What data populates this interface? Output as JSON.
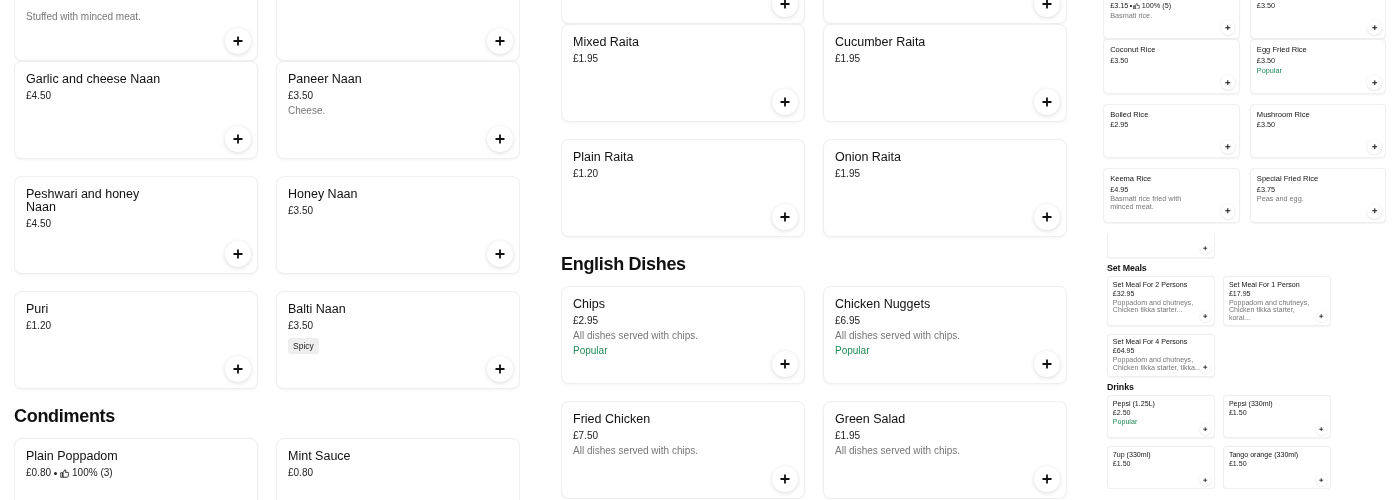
{
  "left_column": {
    "sections": [
      {
        "items": [
          {
            "kind": "tail",
            "description": "Stuffed with minced meat."
          },
          {
            "kind": "tail"
          }
        ]
      },
      {
        "items": [
          {
            "kind": "full",
            "name": "Garlic and cheese Naan",
            "price": "£4.50"
          },
          {
            "kind": "full",
            "name": "Paneer Naan",
            "price": "£3.50",
            "description": "Cheese."
          },
          {
            "kind": "full",
            "name": "Peshwari and honey Naan",
            "price": "£4.50"
          },
          {
            "kind": "full",
            "name": "Honey Naan",
            "price": "£3.50"
          },
          {
            "kind": "full",
            "name": "Puri",
            "price": "£1.20"
          },
          {
            "kind": "full",
            "name": "Balti Naan",
            "price": "£3.50",
            "tag": {
              "kind": "spicy",
              "text": "Spicy"
            }
          }
        ]
      },
      {
        "heading": "Condiments",
        "items": [
          {
            "kind": "head",
            "name": "Plain Poppadom",
            "price": "£0.80",
            "rating": "100% (3)"
          },
          {
            "kind": "head",
            "name": "Mint Sauce",
            "price": "£0.80"
          }
        ]
      }
    ]
  },
  "middle_column": {
    "sections": [
      {
        "items": [
          {
            "kind": "tail"
          },
          {
            "kind": "tail"
          }
        ]
      },
      {
        "items": [
          {
            "kind": "full",
            "name": "Mixed Raita",
            "price": "£1.95"
          },
          {
            "kind": "full",
            "name": "Cucumber Raita",
            "price": "£1.95"
          },
          {
            "kind": "full",
            "name": "Plain Raita",
            "price": "£1.20"
          },
          {
            "kind": "full",
            "name": "Onion Raita",
            "price": "£1.95"
          }
        ]
      },
      {
        "heading": "English Dishes",
        "items": [
          {
            "kind": "full",
            "name": "Chips",
            "price": "£2.95",
            "description": "All dishes served with chips.",
            "tag": {
              "kind": "popular",
              "text": "Popular"
            }
          },
          {
            "kind": "full",
            "name": "Chicken Nuggets",
            "price": "£6.95",
            "description": "All dishes served with chips.",
            "tag": {
              "kind": "popular",
              "text": "Popular"
            }
          },
          {
            "kind": "full",
            "name": "Fried Chicken",
            "price": "£7.50",
            "description": "All dishes served with chips."
          },
          {
            "kind": "full",
            "name": "Green Salad",
            "price": "£1.95",
            "description": "All dishes served with chips."
          }
        ]
      }
    ]
  },
  "right_column": {
    "upper": {
      "sections": [
        {
          "items": [
            {
              "kind": "tail",
              "price": "£3.15",
              "rating": "100% (5)",
              "description": "Basmati rice."
            },
            {
              "kind": "tail",
              "price": "£3.50"
            }
          ]
        },
        {
          "items": [
            {
              "kind": "full",
              "name": "Coconut Rice",
              "price": "£3.50"
            },
            {
              "kind": "full",
              "name": "Egg Fried Rice",
              "price": "£3.50",
              "tag": {
                "kind": "popular",
                "text": "Popular"
              }
            },
            {
              "kind": "full",
              "name": "Boiled Rice",
              "price": "£2.95"
            },
            {
              "kind": "full",
              "name": "Mushroom Rice",
              "price": "£3.50"
            },
            {
              "kind": "full",
              "name": "Keema Rice",
              "price": "£4.95",
              "description": "Basmati rice fried with minced meat."
            },
            {
              "kind": "full",
              "name": "Special Fried Rice",
              "price": "£3.75",
              "description": "Peas and egg."
            }
          ]
        }
      ]
    },
    "lower": {
      "sections": [
        {
          "items": [
            {
              "kind": "tail"
            }
          ]
        },
        {
          "heading": "Set Meals",
          "items": [
            {
              "kind": "full",
              "name": "Set Meal For 2 Persons",
              "price": "£32.95",
              "description": "Poppadom and chutneys, Chicken tikka starter..."
            },
            {
              "kind": "full",
              "name": "Set Meal For 1 Person",
              "price": "£17.95",
              "description": "Poppadom and chutneys, Chicken tikka starter, korai..."
            },
            {
              "kind": "full",
              "name": "Set Meal For 4 Persons",
              "price": "£64.95",
              "description": "Poppadom and chutneys, Chicken tikka starter, tikka..."
            }
          ]
        },
        {
          "heading": "Drinks",
          "items": [
            {
              "kind": "full",
              "name": "Pepsi (1.25L)",
              "price": "£2.50",
              "tag": {
                "kind": "popular",
                "text": "Popular"
              }
            },
            {
              "kind": "full",
              "name": "Pepsi (330ml)",
              "price": "£1.50"
            },
            {
              "kind": "full",
              "name": "7up (330ml)",
              "price": "£1.50"
            },
            {
              "kind": "full",
              "name": "Tango orange (330ml)",
              "price": "£1.50"
            }
          ]
        }
      ]
    }
  }
}
